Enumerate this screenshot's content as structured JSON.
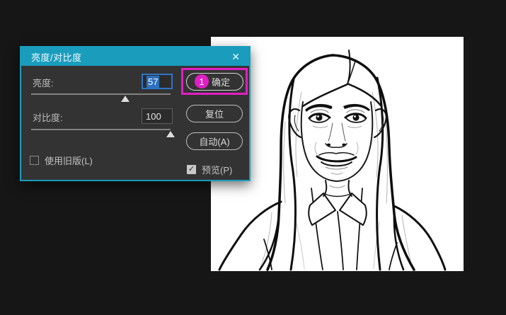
{
  "dialog": {
    "title": "亮度/对比度",
    "close": "✕",
    "fields": {
      "brightness": {
        "label": "亮度:",
        "value": "57",
        "slider_pct": 67.5
      },
      "contrast": {
        "label": "对比度:",
        "value": "100",
        "slider_pct": 100
      }
    },
    "checkboxes": {
      "legacy": {
        "label": "使用旧版(L)",
        "checked": false,
        "checkmark": ""
      },
      "preview": {
        "label": "预览(P)",
        "checked": true,
        "checkmark": "✓"
      }
    },
    "buttons": {
      "ok": "确定",
      "reset": "复位",
      "auto": "自动(A)"
    },
    "annotation": {
      "step": "1",
      "color": "#e01ec3"
    }
  },
  "colors": {
    "window_bg": "#161616",
    "titlebar": "#1a9dbd",
    "dialog_bg": "#333333",
    "focus_border": "#2e75c9",
    "text_selection": "#2e6fbe",
    "annotation": "#e01ec3",
    "canvas_bg": "#ffffff",
    "line_art": "#111111"
  }
}
